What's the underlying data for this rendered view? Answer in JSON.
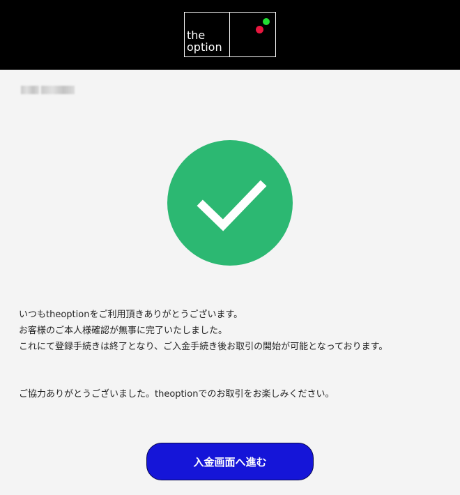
{
  "header": {
    "logo_line1": "the",
    "logo_line2": "option",
    "logo_colors": {
      "green": "#22dd33",
      "red": "#e8173f"
    }
  },
  "status": {
    "icon": "checkmark-icon",
    "color": "#2cb872"
  },
  "message": {
    "line1": "いつもtheoptionをご利用頂きありがとうございます。",
    "line2": "お客様のご本人様確認が無事に完了いたしました。",
    "line3": "これにて登録手続きは終了となり、ご入金手続き後お取引の開始が可能となっております。",
    "thanks": "ご協力ありがとうございました。theoptionでのお取引をお楽しみください。"
  },
  "actions": {
    "deposit_label": "入金画面へ進む",
    "deposit_color": "#1515d8"
  }
}
